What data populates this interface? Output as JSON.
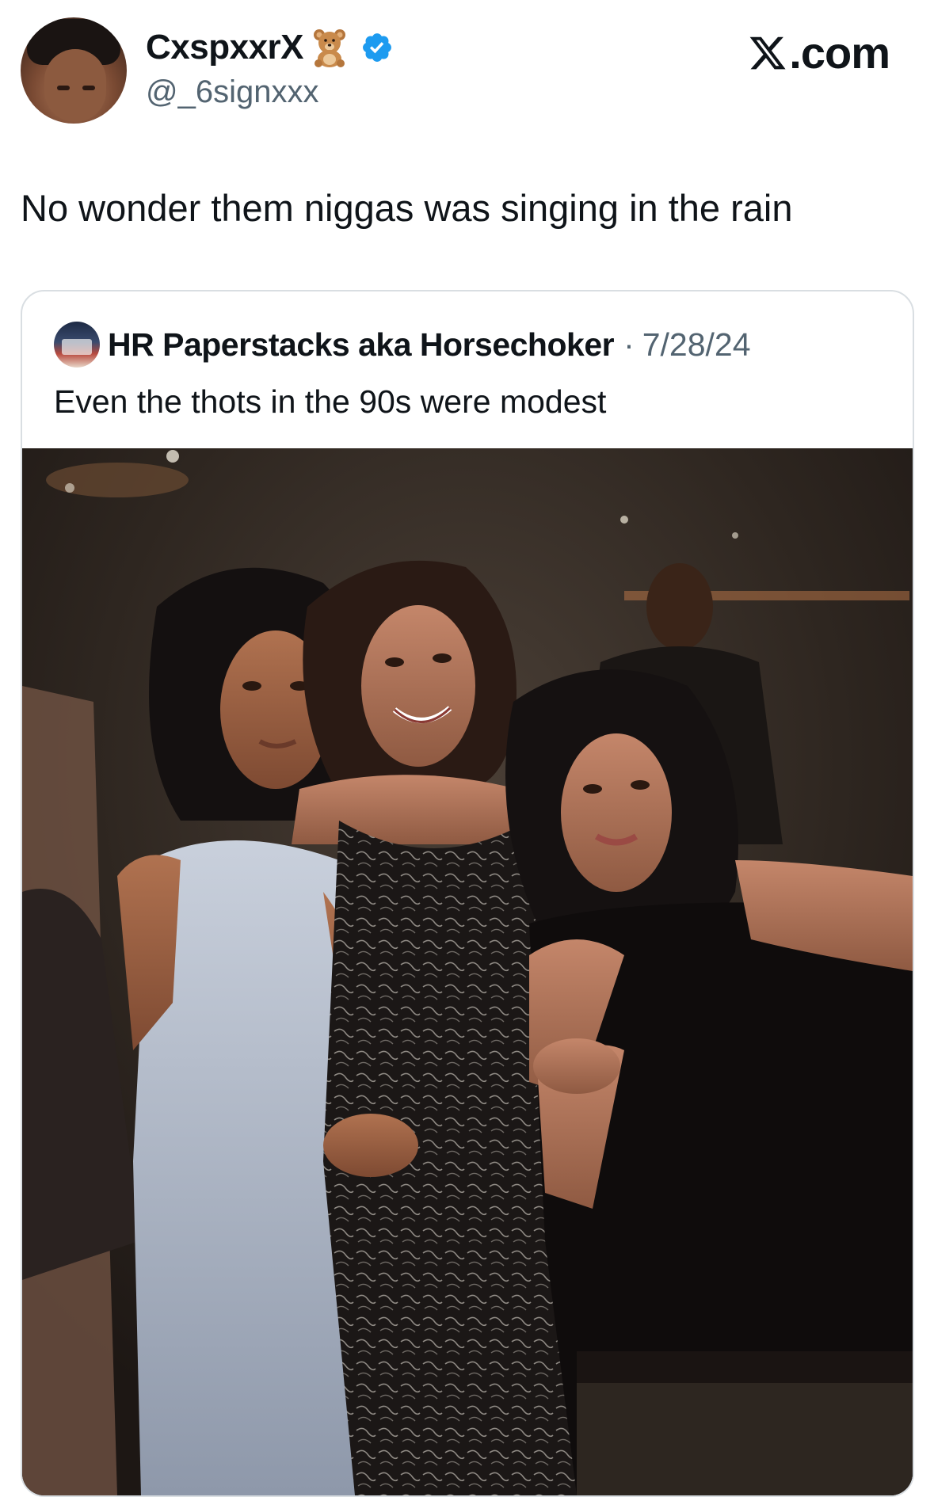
{
  "author": {
    "display_name": "CxspxxrX",
    "handle": "@_6signxxx",
    "avatar_icon": "profile-photo",
    "badge_icon": "teddy-bear-icon",
    "verified_icon": "verified-badge-icon",
    "verified_color": "#1d9bf0"
  },
  "brand": {
    "label": ".com",
    "logo_icon": "x-logo-icon"
  },
  "tweet": {
    "text": "No wonder them niggas was singing in the rain"
  },
  "quoted_tweet": {
    "author_name": "HR Paperstacks aka Horsechoker",
    "separator": "·",
    "date": "7/28/24",
    "text": "Even the thots in the 90s were modest",
    "image_icon": "photo-three-women"
  },
  "colors": {
    "text_primary": "#0f1419",
    "text_secondary": "#536471",
    "border": "#d9dee2"
  }
}
